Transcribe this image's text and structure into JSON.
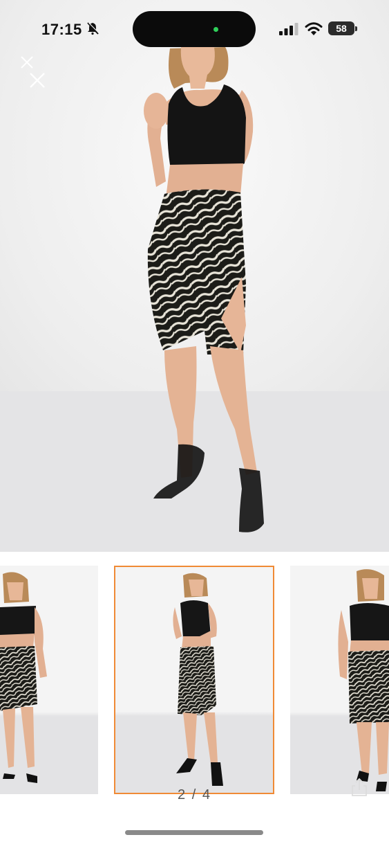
{
  "status_bar": {
    "time": "17:15",
    "battery": "58",
    "icons": [
      "bell-muted-icon",
      "signal-icon",
      "wifi-icon",
      "battery-icon"
    ]
  },
  "viewer": {
    "counter": "2 / 4",
    "selected_index": 2,
    "total": 4,
    "accent_color": "#f08a35",
    "thumbnail_count": 3
  },
  "icons": {
    "close": "close-icon",
    "share": "share-icon"
  }
}
